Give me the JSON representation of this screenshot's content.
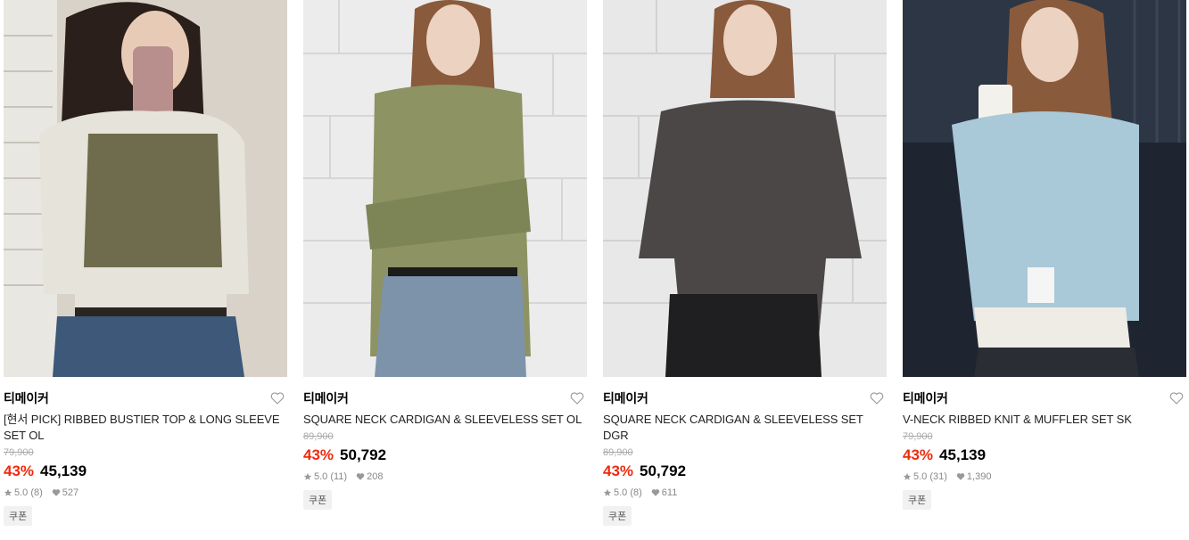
{
  "products": [
    {
      "brand": "티메이커",
      "name": "[현서 PICK] RIBBED BUSTIER TOP & LONG SLEEVE SET OL",
      "original_price": "79,900",
      "discount": "43%",
      "price": "45,139",
      "rating": "5.0 (8)",
      "likes": "527",
      "coupon": "쿠폰",
      "colors": {
        "bg": "#d9d2c8",
        "top": "#6f6b4d",
        "sleeve": "#e6e3da",
        "jeans": "#3d5878",
        "hair": "#2a1f1b"
      }
    },
    {
      "brand": "티메이커",
      "name": "SQUARE NECK CARDIGAN & SLEEVELESS SET OL",
      "original_price": "89,900",
      "discount": "43%",
      "price": "50,792",
      "rating": "5.0 (11)",
      "likes": "208",
      "coupon": "쿠폰",
      "colors": {
        "bg": "#ececec",
        "top": "#8d9363",
        "sleeve": "#8d9363",
        "jeans": "#7d93aa",
        "hair": "#8a5a3c"
      }
    },
    {
      "brand": "티메이커",
      "name": "SQUARE NECK CARDIGAN & SLEEVELESS SET DGR",
      "original_price": "89,900",
      "discount": "43%",
      "price": "50,792",
      "rating": "5.0 (8)",
      "likes": "611",
      "coupon": "쿠폰",
      "colors": {
        "bg": "#e8e8e8",
        "top": "#4b4746",
        "sleeve": "#4b4746",
        "jeans": "#1f1f22",
        "hair": "#8a5a3c"
      }
    },
    {
      "brand": "티메이커",
      "name": "V-NECK RIBBED KNIT & MUFFLER SET SK",
      "original_price": "79,900",
      "discount": "43%",
      "price": "45,139",
      "rating": "5.0 (31)",
      "likes": "1,390",
      "coupon": "쿠폰",
      "colors": {
        "bg": "#2c3644",
        "top": "#a9c8d8",
        "sleeve": "#a9c8d8",
        "jeans": "#2a2d33",
        "hair": "#8a5a3c"
      }
    }
  ]
}
